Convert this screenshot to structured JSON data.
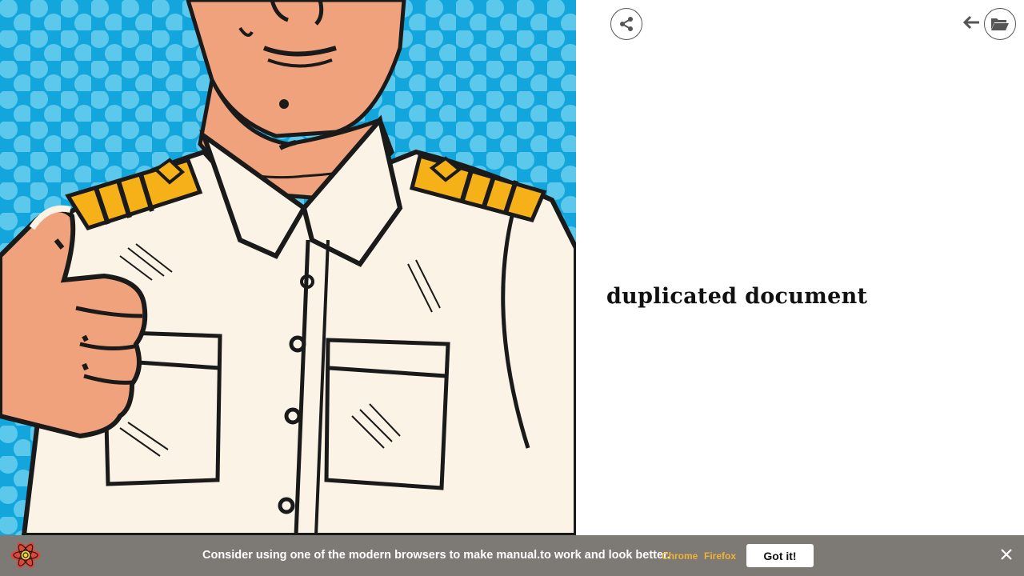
{
  "illustration": {
    "description_icon": "pop-art-captain-thumbs-up-illustration",
    "background_color": "#12a6dd",
    "dot_color": "#5cc9ec",
    "skin_color": "#f0a27c",
    "shirt_color": "#fbf3e6",
    "epaulette_color": "#f5b117"
  },
  "toolbar": {
    "share_icon": "share-icon",
    "back_icon": "arrow-left-icon",
    "folder_icon": "folder-open-icon"
  },
  "document": {
    "title": "duplicated document"
  },
  "banner": {
    "logo_icon": "react-atom-logo",
    "message": "Consider using one of the modern browsers to make manual.to work and look better.",
    "links": [
      "Chrome",
      "Firefox"
    ],
    "got_it_label": "Got it!",
    "close_icon": "close-icon",
    "background_color": "#7d7a76",
    "link_color": "#f2b233"
  }
}
